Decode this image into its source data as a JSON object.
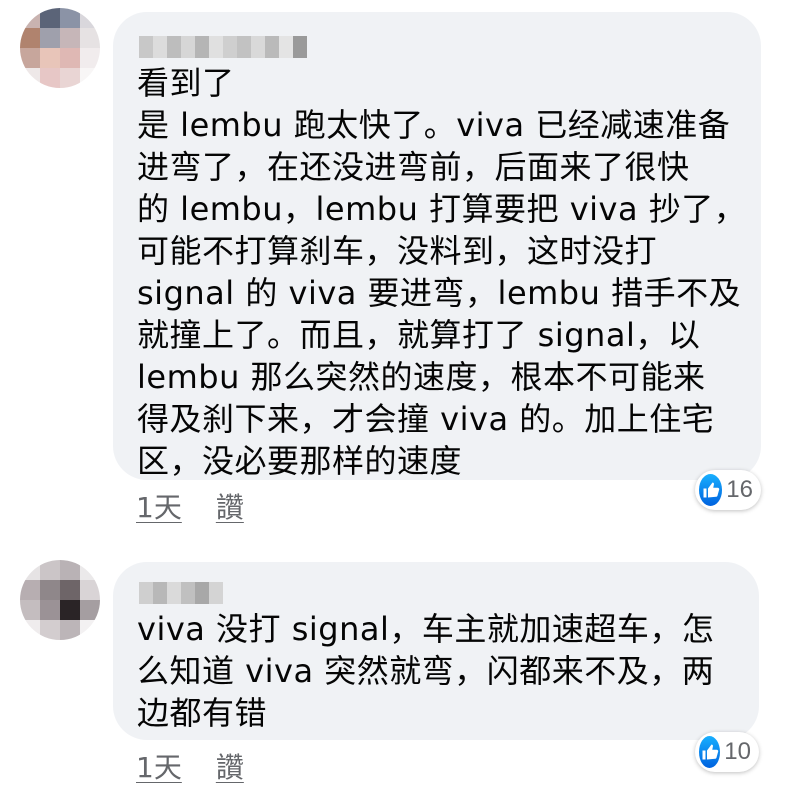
{
  "comments": [
    {
      "lines": [
        "看到了",
        "是 lembu 跑太快了。viva 已经减速准备",
        "进弯了，在还没进弯前，后面来了很快",
        "的 lembu，lembu 打算要把 viva 抄了，",
        "可能不打算刹车，没料到，这时没打",
        "signal 的 viva 要进弯，lembu 措手不及",
        "就撞上了。而且，就算打了 signal，以",
        "lembu 那么突然的速度，根本不可能来",
        "得及刹下来，才会撞 viva 的。加上住宅",
        "区，没必要那样的速度"
      ],
      "time": "1天",
      "like_label": "讚",
      "reaction_count": "16"
    },
    {
      "lines": [
        "viva 没打 signal，车主就加速超车，怎",
        "么知道 viva 突然就弯，闪都来不及，两",
        "边都有错"
      ],
      "time": "1天",
      "like_label": "讚",
      "reaction_count": "10"
    }
  ],
  "colors": {
    "bubble": "#f0f2f5",
    "meta_text": "#65676b",
    "like_blue": "#1877f2"
  },
  "icons": {
    "reaction": "thumbs-up-icon"
  }
}
